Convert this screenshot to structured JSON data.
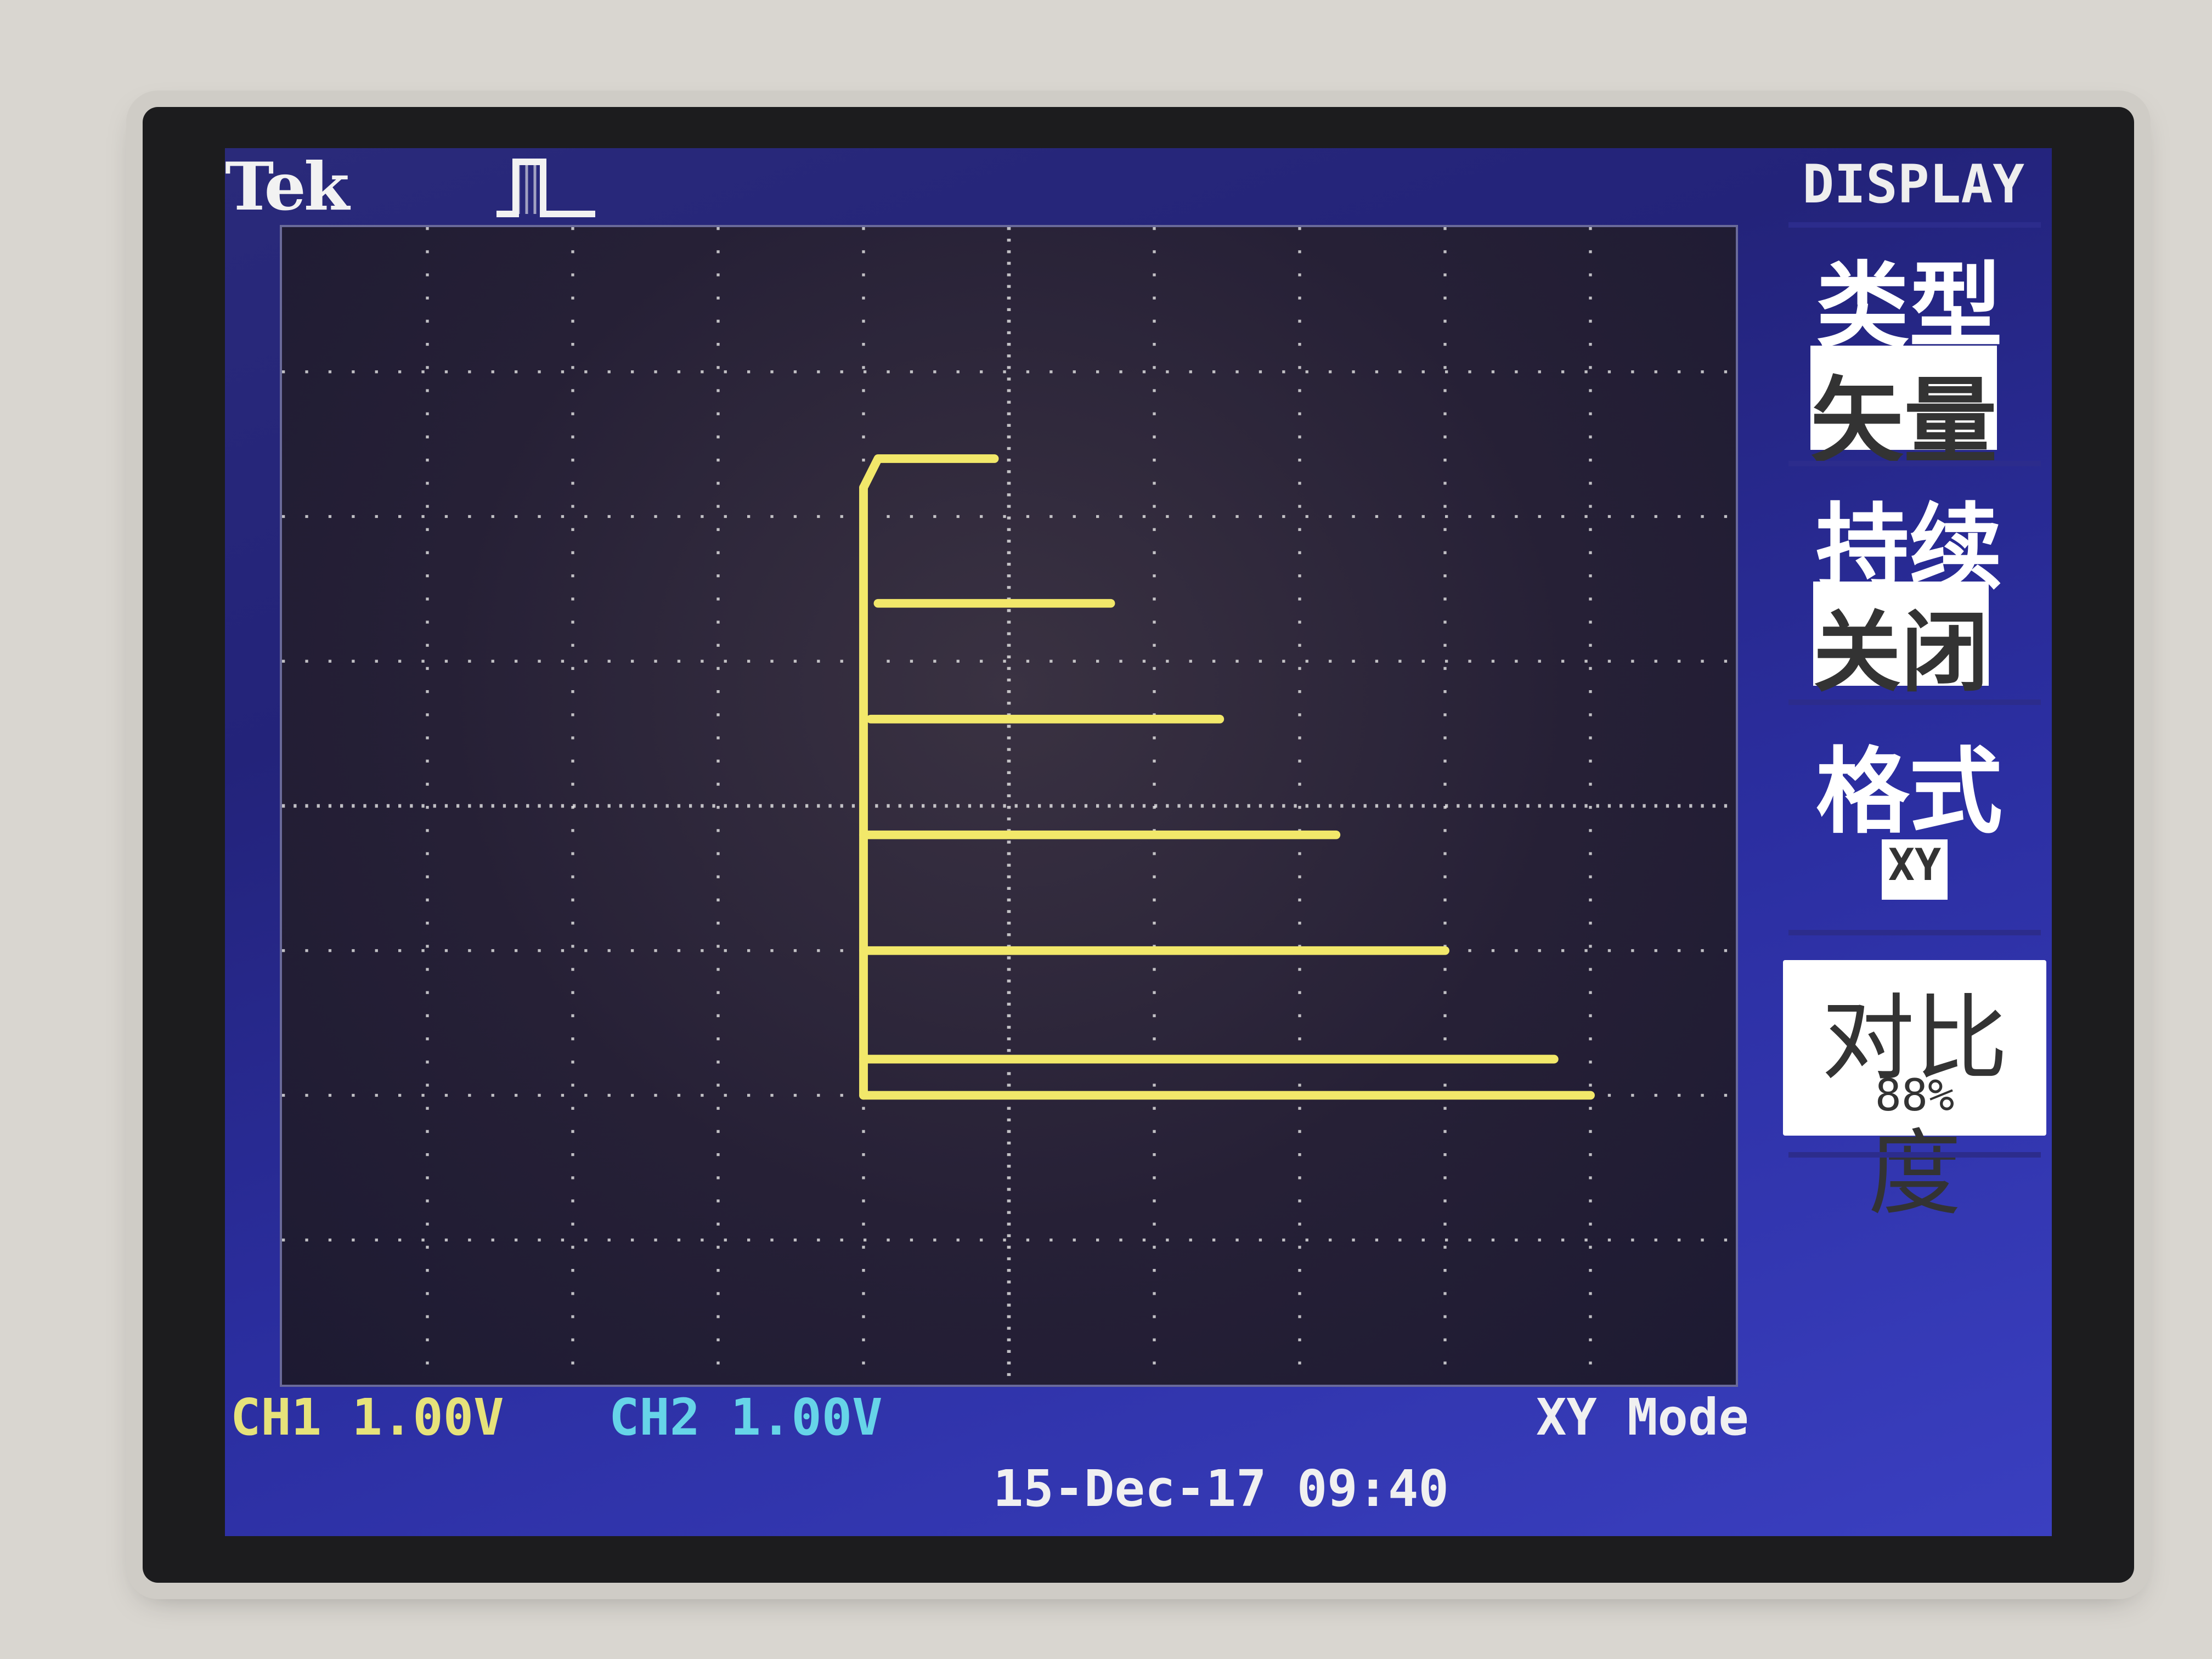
{
  "header": {
    "brand": "Tek",
    "trigger_status_icon": "trigger-pulse-icon"
  },
  "menu": {
    "title": "DISPLAY",
    "items": [
      {
        "label": "类型",
        "value": "矢量"
      },
      {
        "label": "持续",
        "value": "关闭"
      },
      {
        "label": "格式",
        "value": "XY"
      },
      {
        "label": "对比度",
        "value": "88%"
      }
    ]
  },
  "status": {
    "ch1": "CH1  1.00V",
    "ch2": "CH2  1.00V",
    "mode": "XY Mode",
    "datetime": "15-Dec-17 09:40"
  },
  "colors": {
    "trace": "#f2e86a",
    "ch1": "#e6e27a",
    "ch2": "#66d4e8",
    "screen_bg": "#262036",
    "menu_bg": "#2b2ea0"
  },
  "chart_data": {
    "type": "line",
    "title": "",
    "xlabel": "",
    "ylabel": "",
    "xlim": [
      -5,
      5
    ],
    "ylim": [
      -4,
      4
    ],
    "grid": true,
    "series": [
      {
        "values": [
          [
            -1.0,
            2.2
          ],
          [
            -0.9,
            2.4
          ],
          [
            -0.1,
            2.4
          ]
        ]
      },
      {
        "values": [
          [
            -0.9,
            1.4
          ],
          [
            0.7,
            1.4
          ]
        ]
      },
      {
        "values": [
          [
            -0.95,
            0.6
          ],
          [
            1.45,
            0.6
          ]
        ]
      },
      {
        "values": [
          [
            -1.0,
            -0.2
          ],
          [
            2.25,
            -0.2
          ]
        ]
      },
      {
        "values": [
          [
            -1.0,
            -1.0
          ],
          [
            3.0,
            -1.0
          ]
        ]
      },
      {
        "values": [
          [
            -1.0,
            -1.75
          ],
          [
            3.75,
            -1.75
          ]
        ]
      },
      {
        "values": [
          [
            -1.0,
            -2.0
          ],
          [
            4.0,
            -2.0
          ]
        ]
      },
      {
        "values": [
          [
            -1.0,
            -2.0
          ],
          [
            -1.0,
            2.2
          ]
        ]
      }
    ]
  }
}
